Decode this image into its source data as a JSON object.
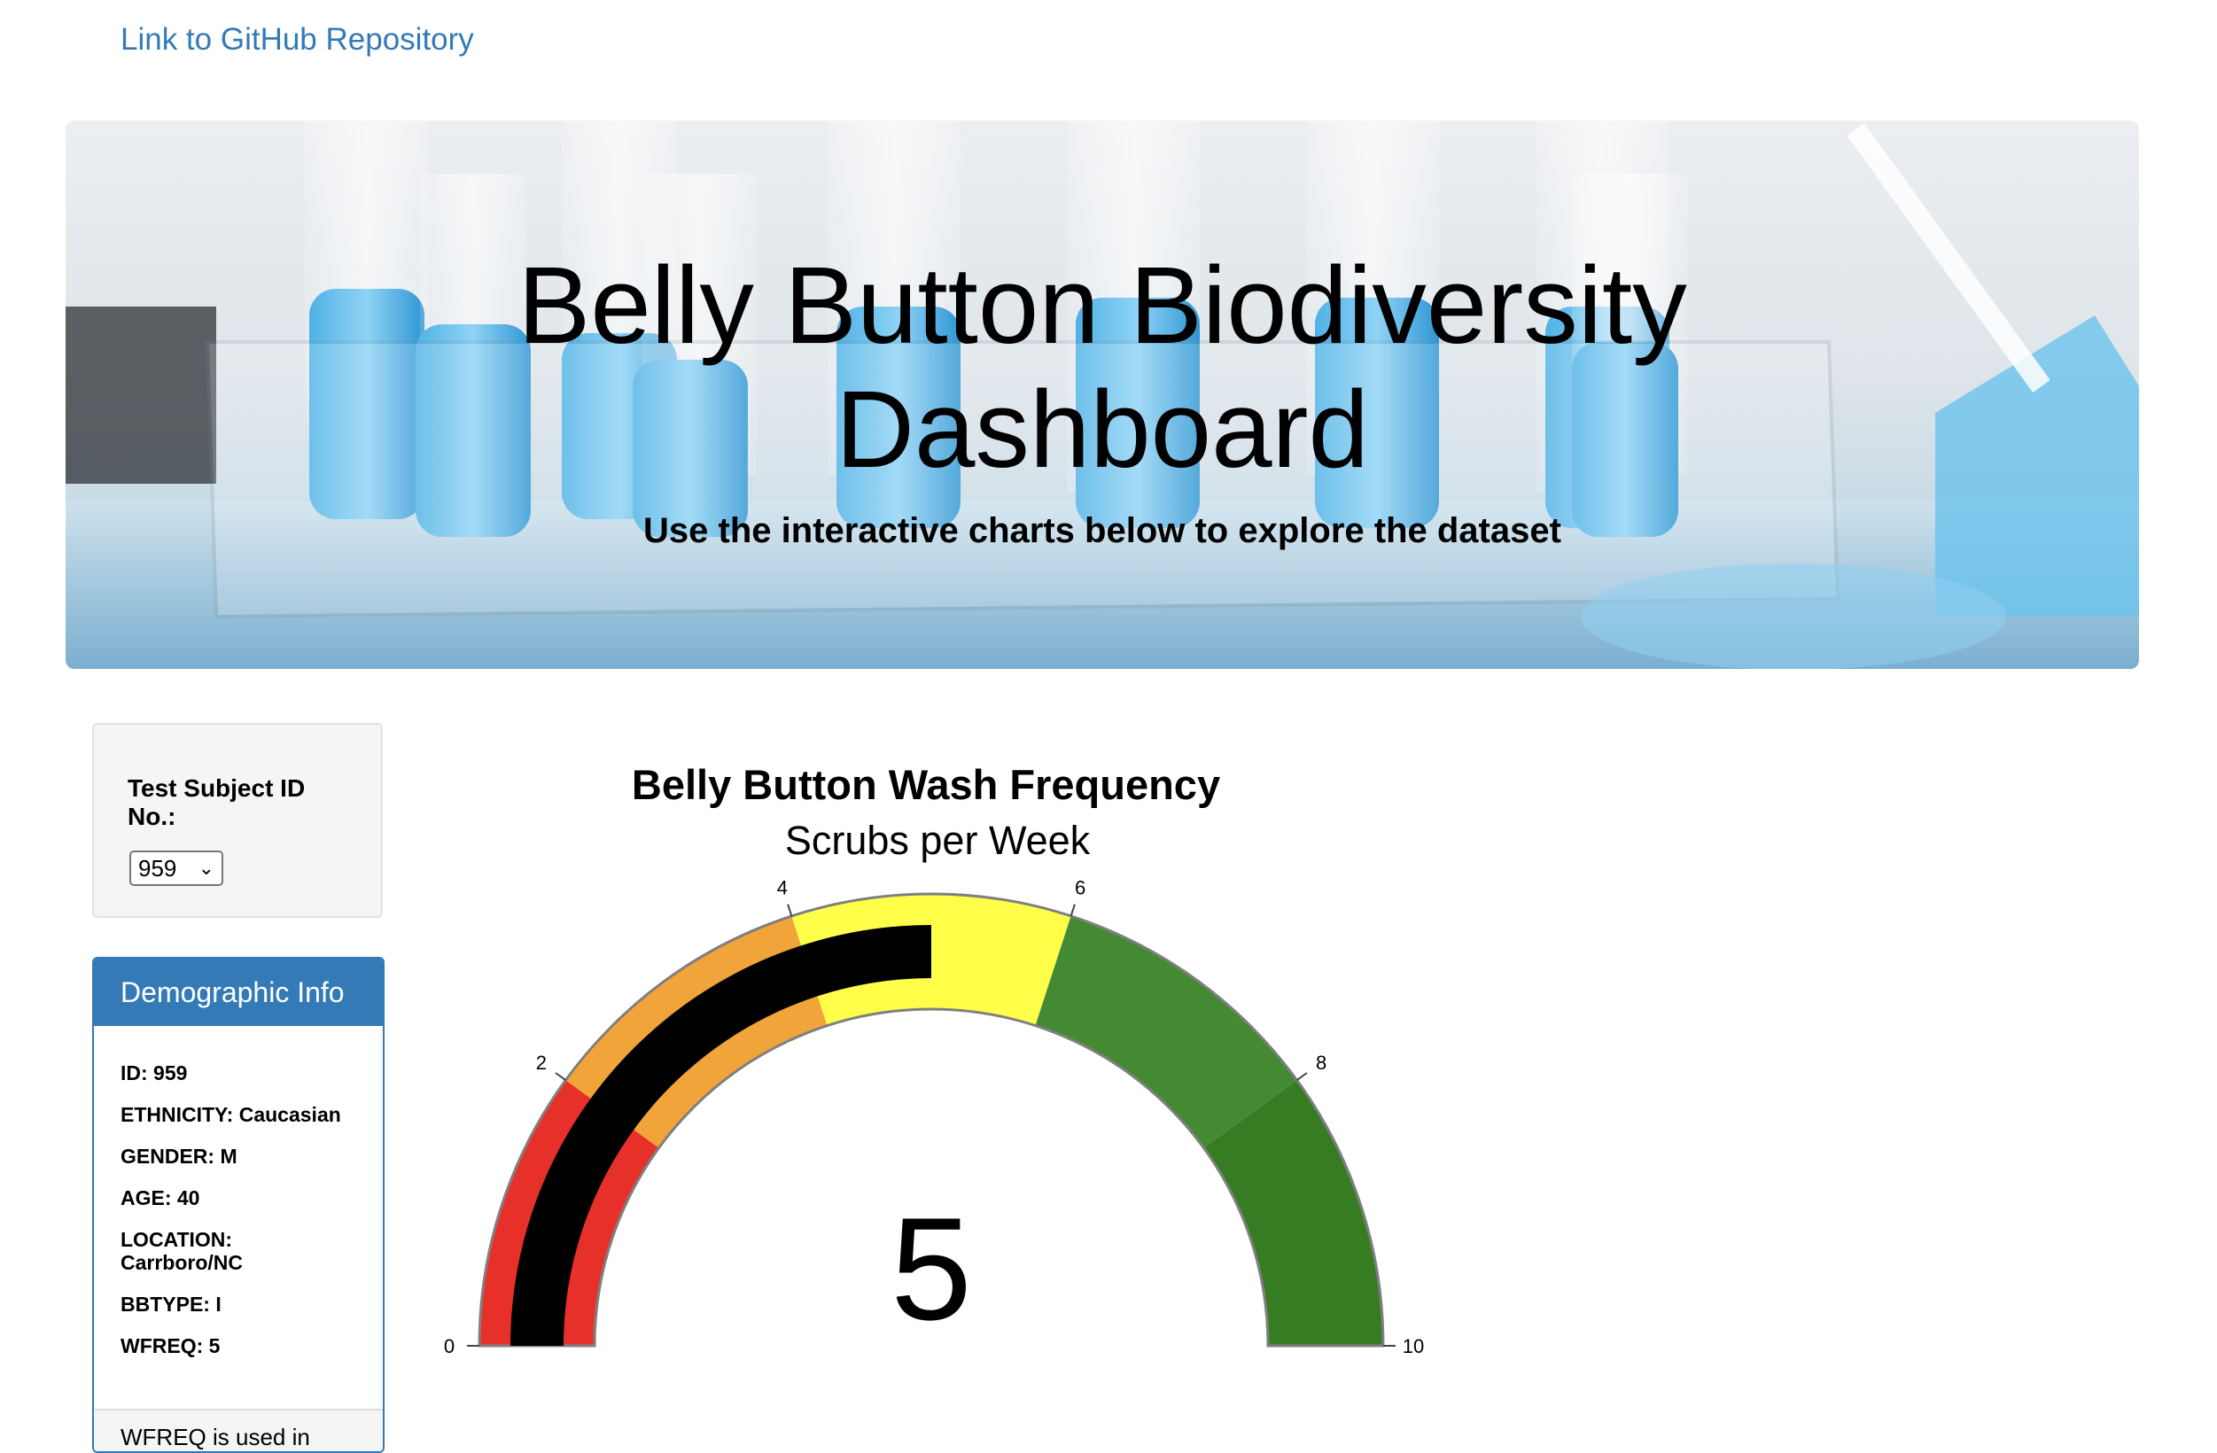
{
  "header": {
    "github_link": "Link to GitHub Repository"
  },
  "jumbotron": {
    "title_line1": "Belly Button Biodiversity",
    "title_line2": "Dashboard",
    "subtitle": "Use the interactive charts below to explore the dataset"
  },
  "selector": {
    "label": "Test Subject ID No.:",
    "selected": "959"
  },
  "demographic": {
    "title": "Demographic Info",
    "rows": [
      "ID: 959",
      "ETHNICITY: Caucasian",
      "GENDER: M",
      "AGE: 40",
      "LOCATION: Carrboro/NC",
      "BBTYPE: I",
      "WFREQ: 5"
    ],
    "footer_text": "WFREQ is used in"
  },
  "colors": {
    "link": "#337ab7",
    "panel_header": "#337ab7",
    "gauge_red": "#e8302a",
    "gauge_orange": "#f0a43a",
    "gauge_yellow": "#ffff4a",
    "gauge_green": "#448a33",
    "gauge_darkgreen": "#367c23",
    "gauge_bar": "#000000"
  },
  "chart_data": {
    "type": "gauge",
    "title": "Belly Button Wash Frequency",
    "subtitle": "Scrubs per Week",
    "value": 5,
    "value_label": "5",
    "range": [
      0,
      10
    ],
    "ticks": [
      {
        "value": 0,
        "label": "0"
      },
      {
        "value": 2,
        "label": "2"
      },
      {
        "value": 4,
        "label": "4"
      },
      {
        "value": 6,
        "label": "6"
      },
      {
        "value": 8,
        "label": "8"
      },
      {
        "value": 10,
        "label": "10"
      }
    ],
    "steps": [
      {
        "from": 0,
        "to": 2,
        "color": "#e8302a"
      },
      {
        "from": 2,
        "to": 4,
        "color": "#f0a43a"
      },
      {
        "from": 4,
        "to": 6,
        "color": "#ffff4a"
      },
      {
        "from": 6,
        "to": 8,
        "color": "#448a33"
      },
      {
        "from": 8,
        "to": 10,
        "color": "#367c23"
      }
    ]
  }
}
